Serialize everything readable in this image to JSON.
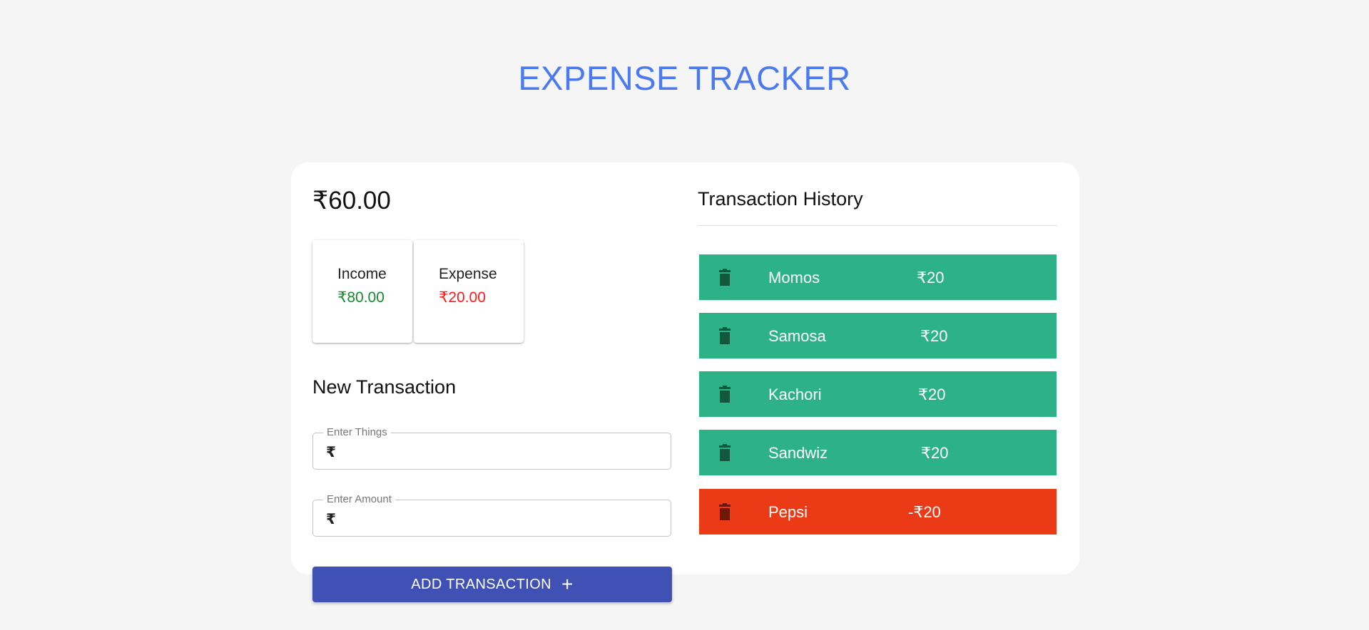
{
  "header": {
    "title": "EXPENSE TRACKER"
  },
  "summary": {
    "balance": "₹60.00",
    "income_label": "Income",
    "income_value": "₹80.00",
    "expense_label": "Expense",
    "expense_value": "₹20.00"
  },
  "new_transaction": {
    "title": "New Transaction",
    "things_label": "Enter Things",
    "things_adornment": "₹",
    "things_value": "",
    "amount_label": "Enter Amount",
    "amount_adornment": "₹",
    "amount_value": "",
    "button_label": "ADD TRANSACTION",
    "button_icon": "+"
  },
  "history": {
    "title": "Transaction History",
    "items": [
      {
        "name": "Momos",
        "amount": "₹20",
        "type": "income"
      },
      {
        "name": "Samosa",
        "amount": "₹20",
        "type": "income"
      },
      {
        "name": "Kachori",
        "amount": "₹20",
        "type": "income"
      },
      {
        "name": "Sandwiz",
        "amount": "₹20",
        "type": "income"
      },
      {
        "name": "Pepsi",
        "amount": "-₹20",
        "type": "expense"
      }
    ]
  },
  "colors": {
    "title": "#4a79f0",
    "income_row": "#2db287",
    "expense_row": "#eb3a16",
    "income_text": "#168a2c",
    "expense_text": "#ff1a1a",
    "button": "#3f51b5"
  }
}
